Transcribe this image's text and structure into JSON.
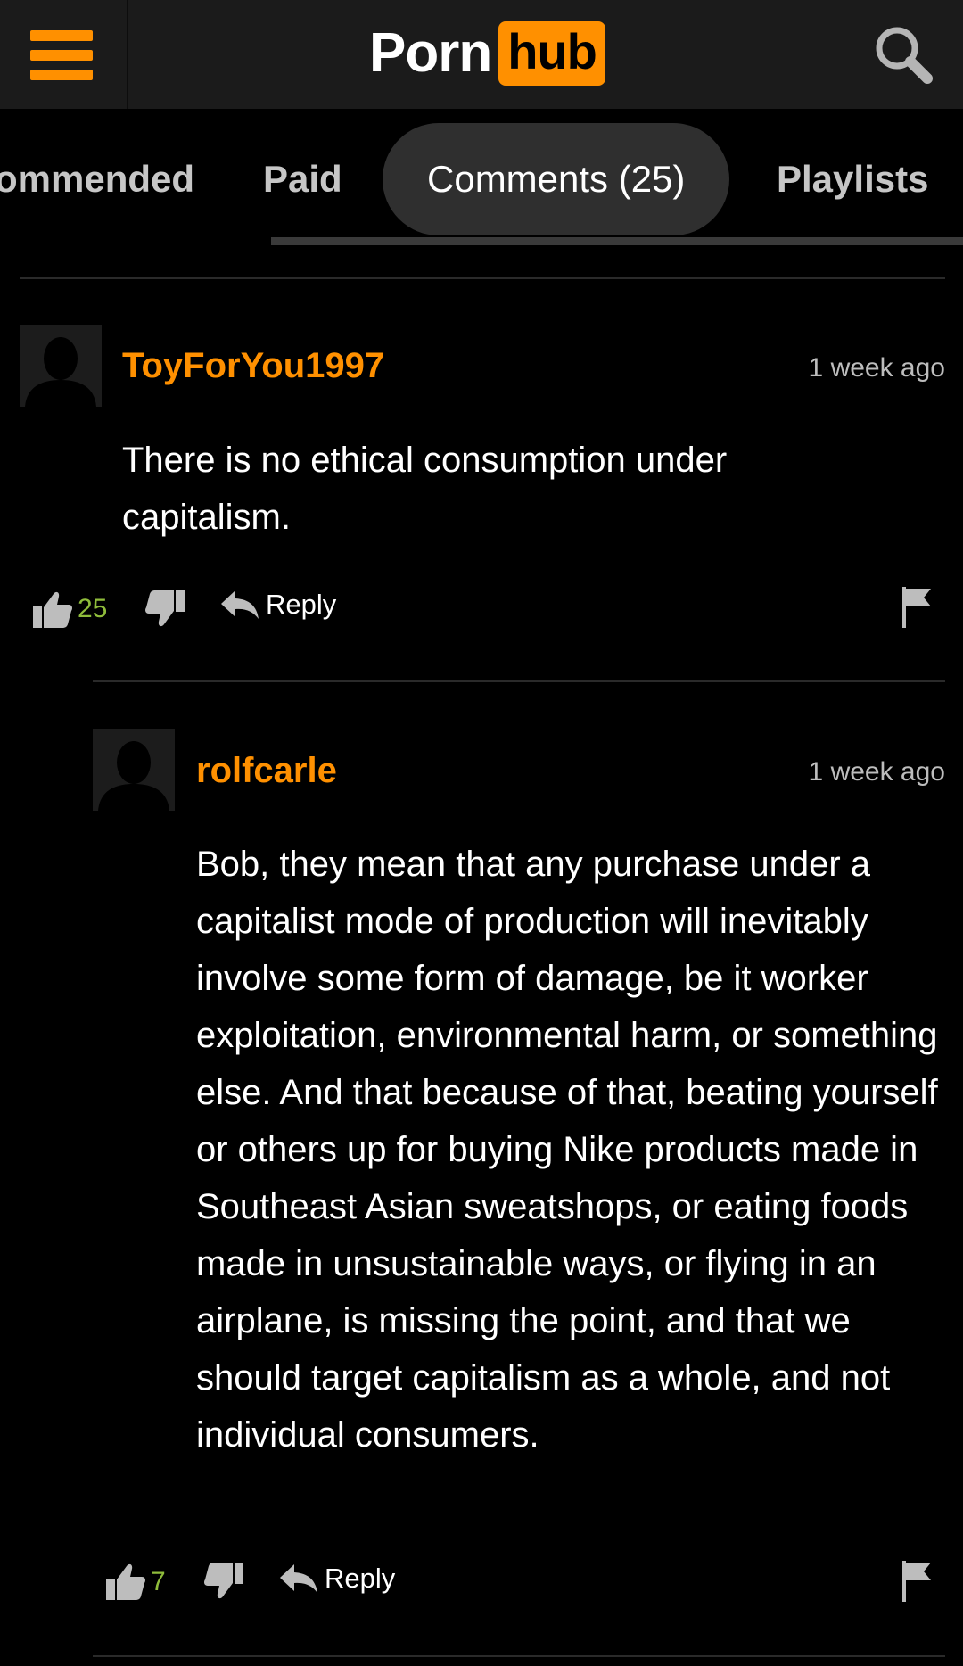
{
  "header": {
    "logo_part1": "Porn",
    "logo_part2": "hub",
    "menu_icon": "hamburger-menu-icon",
    "search_icon": "search-icon",
    "brand_color": "#ff9000"
  },
  "tabs": [
    {
      "label": "ommended",
      "active": false
    },
    {
      "label": "Paid",
      "active": false
    },
    {
      "label": "Comments (25)",
      "active": true
    },
    {
      "label": "Playlists",
      "active": false
    }
  ],
  "comments": [
    {
      "username": "ToyForYou1997",
      "timestamp": "1 week ago",
      "text": "There is no ethical consumption under capitalism.",
      "likes": "25",
      "reply_label": "Reply"
    },
    {
      "username": "rolfcarle",
      "timestamp": "1 week ago",
      "text": "Bob, they mean that any purchase under a capitalist mode of production will inevitably involve some form of damage, be it worker exploitation, environmental harm, or something else. And that because of that, beating yourself or others up for buying Nike products made in Southeast Asian sweatshops, or eating foods made in unsustainable ways, or flying in an airplane, is missing the point, and that we should target capitalism as a whole, and not individual consumers.",
      "likes": "7",
      "reply_label": "Reply"
    }
  ]
}
